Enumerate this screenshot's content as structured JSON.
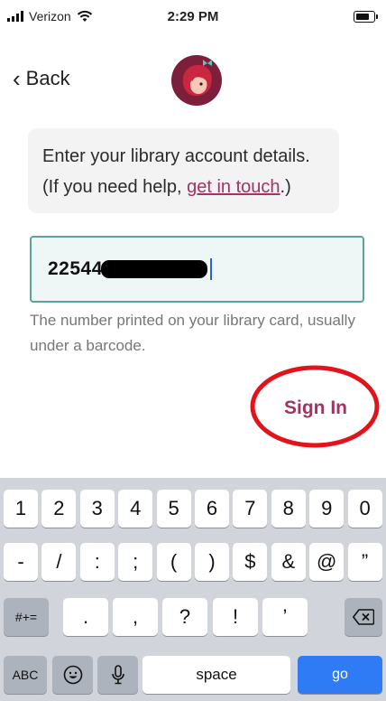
{
  "status": {
    "carrier": "Verizon",
    "time": "2:29 PM"
  },
  "nav": {
    "back_label": "Back"
  },
  "info": {
    "line1": "Enter your library account details.",
    "line2_prefix": "(If you need help, ",
    "help_link": "get in touch",
    "line2_suffix": ".)"
  },
  "card_field": {
    "visible_value": "22544"
  },
  "helper_text": "The number printed on your library card, usually under a barcode.",
  "signin_label": "Sign In",
  "keyboard": {
    "row1": [
      "1",
      "2",
      "3",
      "4",
      "5",
      "6",
      "7",
      "8",
      "9",
      "0"
    ],
    "row2": [
      "-",
      "/",
      ":",
      ";",
      "(",
      ")",
      "$",
      "&",
      "@",
      "”"
    ],
    "row3": [
      ".",
      ",",
      "?",
      "!",
      "’"
    ],
    "mode_key": "#+=",
    "abc_key": "ABC",
    "space_key": "space",
    "go_key": "go"
  },
  "colors": {
    "accent": "#a13462",
    "field_border": "#5aa397",
    "go_key": "#2f7bf6",
    "annotation": "#e2141b"
  }
}
